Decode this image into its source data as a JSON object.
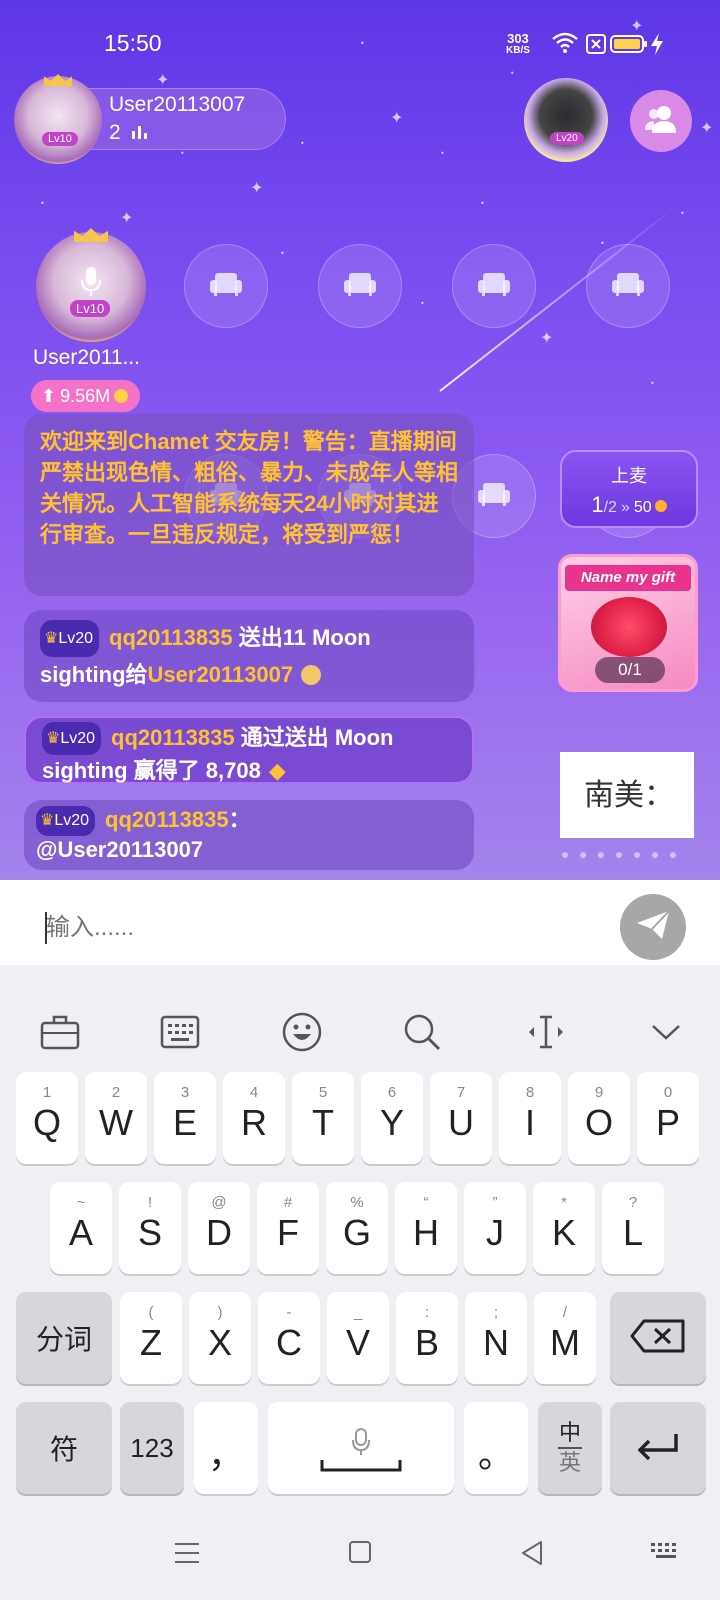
{
  "status_bar": {
    "time": "15:50",
    "net_speed_value": "303",
    "net_speed_unit": "KB/S",
    "icons": [
      "wifi-icon",
      "sim-off-icon",
      "battery-icon",
      "charging-icon"
    ]
  },
  "host": {
    "name": "User20113007",
    "level": "Lv10",
    "count": "2"
  },
  "top_right": {
    "avatar_level": "Lv20",
    "users_button_icon": "users-icon"
  },
  "seats": {
    "occupied": {
      "name": "User2011...",
      "level": "Lv10",
      "score": "9.56M"
    },
    "empty_icon": "sofa-icon"
  },
  "messages": {
    "system": "欢迎来到Chamet 交友房！警告：直播期间严禁出现色情、粗俗、暴力、未成年人等相关情况。人工智能系统每天24小时对其进行审查。一旦违反规定，将受到严惩！",
    "gift": {
      "level": "Lv20",
      "user": "qq20113835",
      "text1": " 送出11 Moon sighting给",
      "target": "User20113007"
    },
    "win": {
      "level": "Lv20",
      "user": "qq20113835",
      "text1": " 通过送出 Moon sighting 赢得了 8,708"
    },
    "mention": {
      "level": "Lv20",
      "user": "qq20113835",
      "sep": "：",
      "text": "@User20113007"
    }
  },
  "side": {
    "mic_title": "上麦",
    "mic_current": "1",
    "mic_total": "/2",
    "mic_cost": "50",
    "gift_banner_title": "Name my gift",
    "gift_progress": "0/1",
    "ad_text": "南美："
  },
  "input": {
    "placeholder": "输入......",
    "send_icon": "send-icon"
  },
  "keyboard": {
    "toolbar": [
      "toolbox-icon",
      "keyboard-icon",
      "emoji-icon",
      "search-icon",
      "cursor-icon",
      "collapse-icon"
    ],
    "row1": [
      {
        "hint": "1",
        "key": "Q"
      },
      {
        "hint": "2",
        "key": "W"
      },
      {
        "hint": "3",
        "key": "E"
      },
      {
        "hint": "4",
        "key": "R"
      },
      {
        "hint": "5",
        "key": "T"
      },
      {
        "hint": "6",
        "key": "Y"
      },
      {
        "hint": "7",
        "key": "U"
      },
      {
        "hint": "8",
        "key": "I"
      },
      {
        "hint": "9",
        "key": "O"
      },
      {
        "hint": "0",
        "key": "P"
      }
    ],
    "row2": [
      {
        "hint": "~",
        "key": "A"
      },
      {
        "hint": "!",
        "key": "S"
      },
      {
        "hint": "@",
        "key": "D"
      },
      {
        "hint": "#",
        "key": "F"
      },
      {
        "hint": "%",
        "key": "G"
      },
      {
        "hint": "“",
        "key": "H"
      },
      {
        "hint": "”",
        "key": "J"
      },
      {
        "hint": "*",
        "key": "K"
      },
      {
        "hint": "?",
        "key": "L"
      }
    ],
    "row3": [
      {
        "hint": "(",
        "key": "Z"
      },
      {
        "hint": ")",
        "key": "X"
      },
      {
        "hint": "-",
        "key": "C"
      },
      {
        "hint": "_",
        "key": "V"
      },
      {
        "hint": ":",
        "key": "B"
      },
      {
        "hint": ";",
        "key": "N"
      },
      {
        "hint": "/",
        "key": "M"
      }
    ],
    "segment_label": "分词",
    "symbol_label": "符",
    "num_label": "123",
    "comma": "，",
    "period": "。",
    "lang_top": "中",
    "lang_bottom": "英"
  },
  "nav_bar": {
    "icons": [
      "menu-icon",
      "home-icon",
      "back-icon",
      "keyboard-switch-icon"
    ]
  }
}
